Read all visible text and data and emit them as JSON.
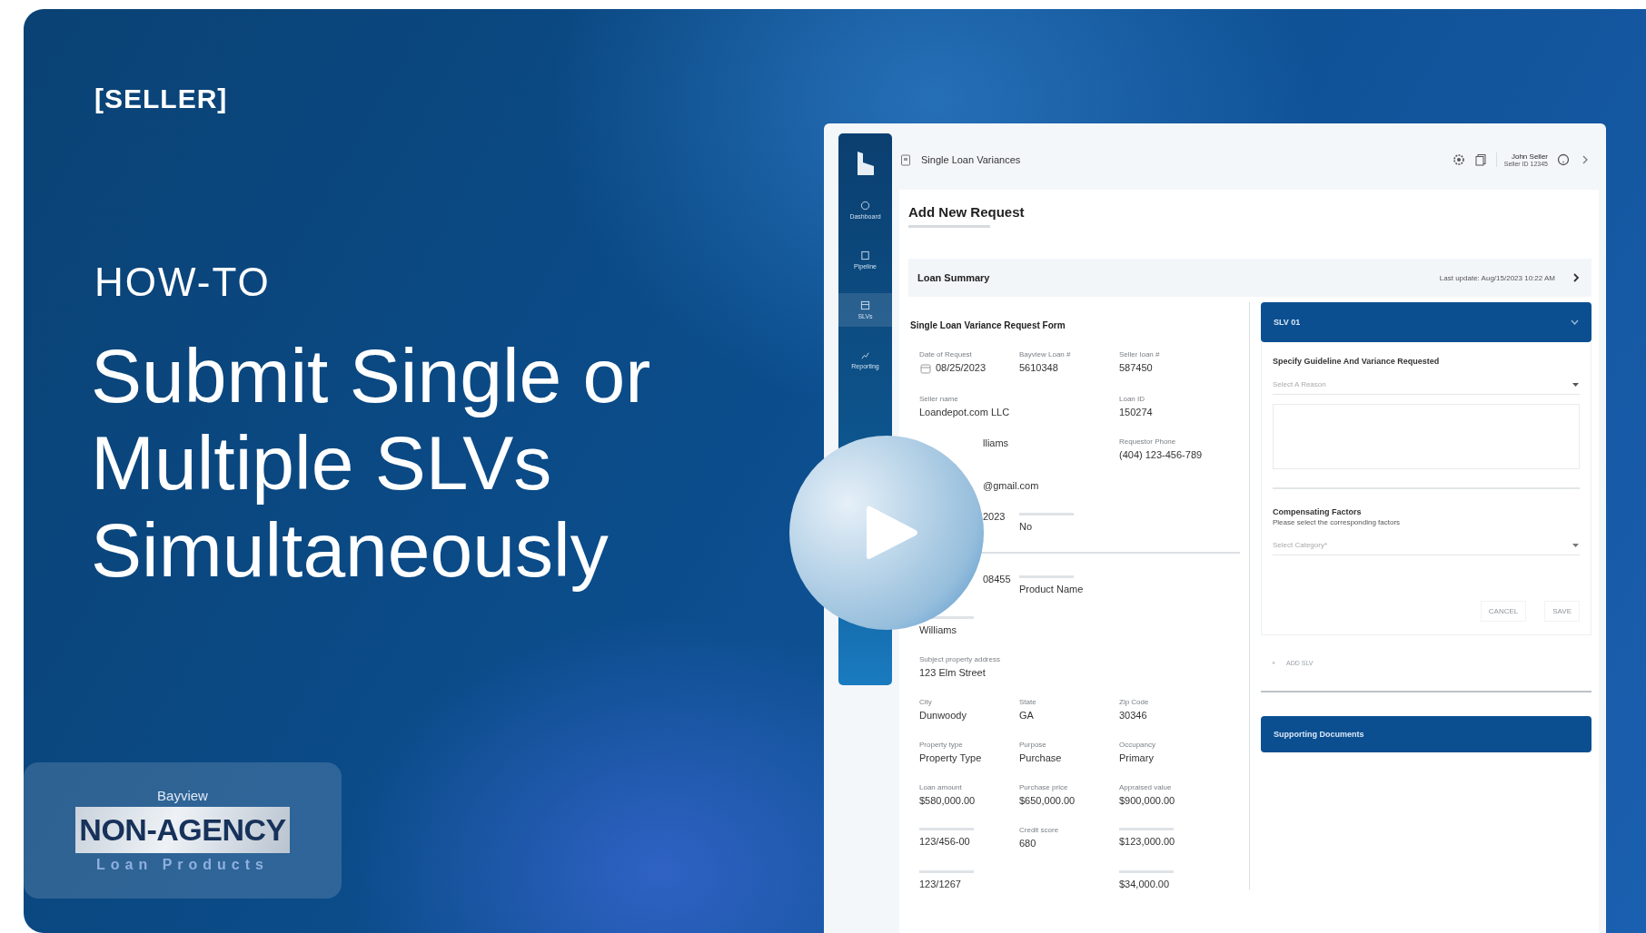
{
  "tag": "[SELLER]",
  "kicker": "HOW-TO",
  "title_lines": [
    "Submit Single or",
    "Multiple SLVs",
    "Simultaneously"
  ],
  "logo": {
    "top": "Bayview",
    "main": "NON-AGENCY",
    "bottom": "Loan Products"
  },
  "app": {
    "sidebar": {
      "items": [
        {
          "label": "Dashboard",
          "selected": false
        },
        {
          "label": "Pipeline",
          "selected": false
        },
        {
          "label": "SLVs",
          "selected": true
        },
        {
          "label": "Reporting",
          "selected": false
        }
      ]
    },
    "header": {
      "title": "Single Loan Variances",
      "user_name": "John Seller",
      "user_id": "Seller ID 12345"
    },
    "page_title": "Add New Request",
    "summary": {
      "title": "Loan Summary",
      "updated": "Last update: Aug/15/2023 10:22 AM"
    },
    "form": {
      "title": "Single Loan Variance Request Form",
      "rows": [
        {
          "kind": "fields",
          "fields": [
            {
              "label": "Date of Request",
              "value": "08/25/2023",
              "kind": "date"
            },
            {
              "label": "Bayview Loan #",
              "value": "5610348"
            },
            {
              "label": "Seller loan #",
              "value": "587450"
            }
          ]
        },
        {
          "kind": "fields",
          "fields": [
            {
              "label": "Seller name",
              "value": "Loandepot.com LLC"
            },
            {
              "kind": "empty"
            },
            {
              "label": "Loan ID",
              "value": "150274"
            }
          ]
        },
        {
          "kind": "fields",
          "fields": [
            {
              "value": "lliams",
              "kind": "covered"
            },
            {
              "kind": "empty"
            },
            {
              "label": "Requestor Phone",
              "value": "(404) 123-456-789"
            }
          ]
        },
        {
          "kind": "fields",
          "fields": [
            {
              "value": "@gmail.com",
              "kind": "covered"
            }
          ]
        },
        {
          "kind": "fields",
          "fields": [
            {
              "value": "2023",
              "kind": "covered"
            },
            {
              "value": "No"
            }
          ]
        },
        {
          "kind": "divider"
        },
        {
          "kind": "fields",
          "fields": [
            {
              "value": "08455",
              "kind": "covered"
            },
            {
              "value": "Product Name"
            }
          ]
        },
        {
          "kind": "fields",
          "fields": [
            {
              "value": "Williams",
              "kind": "wide"
            }
          ]
        },
        {
          "kind": "fields",
          "fields": [
            {
              "label": "Subject property address",
              "value": "123 Elm Street",
              "kind": "wide"
            }
          ]
        },
        {
          "kind": "fields",
          "fields": [
            {
              "label": "City",
              "value": "Dunwoody"
            },
            {
              "label": "State",
              "value": "GA"
            },
            {
              "label": "Zip Code",
              "value": "30346"
            }
          ]
        },
        {
          "kind": "fields",
          "fields": [
            {
              "label": "Property type",
              "value": "Property Type"
            },
            {
              "label": "Purpose",
              "value": "Purchase"
            },
            {
              "label": "Occupancy",
              "value": "Primary"
            }
          ]
        },
        {
          "kind": "fields",
          "fields": [
            {
              "label": "Loan amount",
              "value": "$580,000.00"
            },
            {
              "label": "Purchase price",
              "value": "$650,000.00"
            },
            {
              "label": "Appraised value",
              "value": "$900,000.00"
            }
          ]
        },
        {
          "kind": "fields",
          "fields": [
            {
              "value": "123/456-00"
            },
            {
              "label": "Credit score",
              "value": "680"
            },
            {
              "value": "$123,000.00"
            }
          ]
        },
        {
          "kind": "fields",
          "fields": [
            {
              "value": "123/1267"
            },
            {
              "kind": "empty"
            },
            {
              "value": "$34,000.00"
            }
          ]
        }
      ]
    },
    "slv": {
      "title": "SLV 01",
      "expanded": true,
      "guideline_title": "Specify Guideline And Variance Requested",
      "reason_placeholder": "Select A Reason",
      "factors_title": "Compensating Factors",
      "factors_hint": "Please select the corresponding factors",
      "category_placeholder": "Select Category*",
      "buttons": [
        {
          "label": "CANCEL",
          "disabled": true
        },
        {
          "label": "SAVE",
          "disabled": true
        }
      ],
      "add_label": "ADD SLV",
      "add_icon": "+"
    },
    "documents_title": "Supporting Documents"
  }
}
